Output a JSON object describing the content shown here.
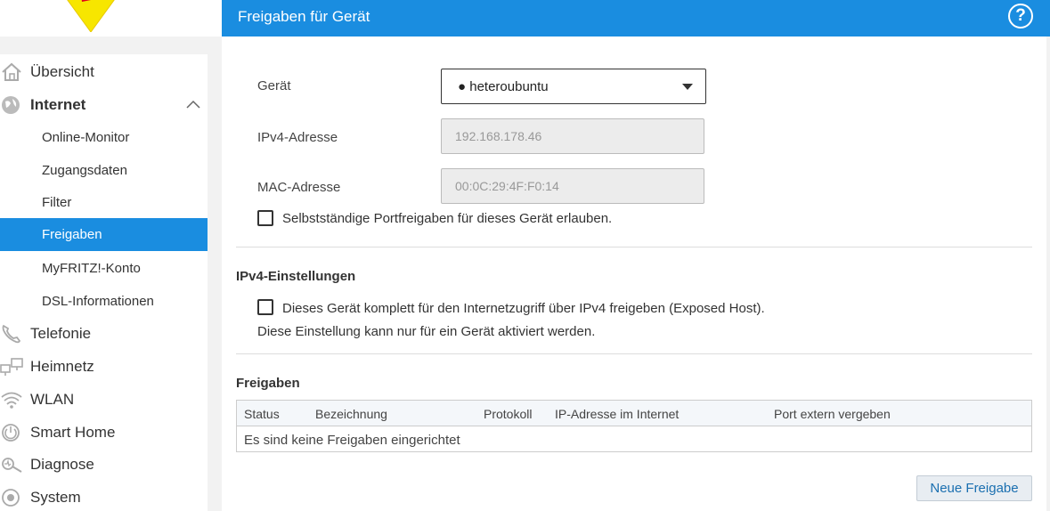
{
  "header": {
    "title": "Freigaben für Gerät",
    "help_symbol": "?"
  },
  "sidebar": {
    "items": [
      {
        "label": "Übersicht",
        "icon": "home-icon"
      },
      {
        "label": "Internet",
        "icon": "globe-icon"
      },
      {
        "label": "Telefonie",
        "icon": "phone-icon"
      },
      {
        "label": "Heimnetz",
        "icon": "network-icon"
      },
      {
        "label": "WLAN",
        "icon": "wifi-icon"
      },
      {
        "label": "Smart Home",
        "icon": "smart-home-icon"
      },
      {
        "label": "Diagnose",
        "icon": "diagnose-icon"
      },
      {
        "label": "System",
        "icon": "system-icon"
      }
    ],
    "internet_sub": [
      {
        "label": "Online-Monitor"
      },
      {
        "label": "Zugangsdaten"
      },
      {
        "label": "Filter"
      },
      {
        "label": "Freigaben",
        "active": true
      },
      {
        "label": "MyFRITZ!-Konto"
      },
      {
        "label": "DSL-Informationen"
      }
    ]
  },
  "form": {
    "device_label": "Gerät",
    "device_value": "● heteroubuntu",
    "ipv4_label": "IPv4-Adresse",
    "ipv4_value": "192.168.178.46",
    "mac_label": "MAC-Adresse",
    "mac_value": "00:0C:29:4F:F0:14",
    "auto_portforward_label": "Selbstständige Portfreigaben für dieses Gerät erlauben.",
    "auto_portforward_checked": false
  },
  "ipv4_settings": {
    "title": "IPv4-Einstellungen",
    "exposed_host_label": "Dieses Gerät komplett für den Internetzugriff über IPv4 freigeben (Exposed Host).",
    "exposed_host_checked": false,
    "note": "Diese Einstellung kann nur für ein Gerät aktiviert werden."
  },
  "freigaben": {
    "title": "Freigaben",
    "columns": [
      "Status",
      "Bezeichnung",
      "Protokoll",
      "IP-Adresse im Internet",
      "Port extern vergeben"
    ],
    "empty_text": "Es sind keine Freigaben eingerichtet",
    "new_button": "Neue Freigabe"
  },
  "colors": {
    "accent": "#1a8de0",
    "button_text": "#1a6fb0"
  }
}
